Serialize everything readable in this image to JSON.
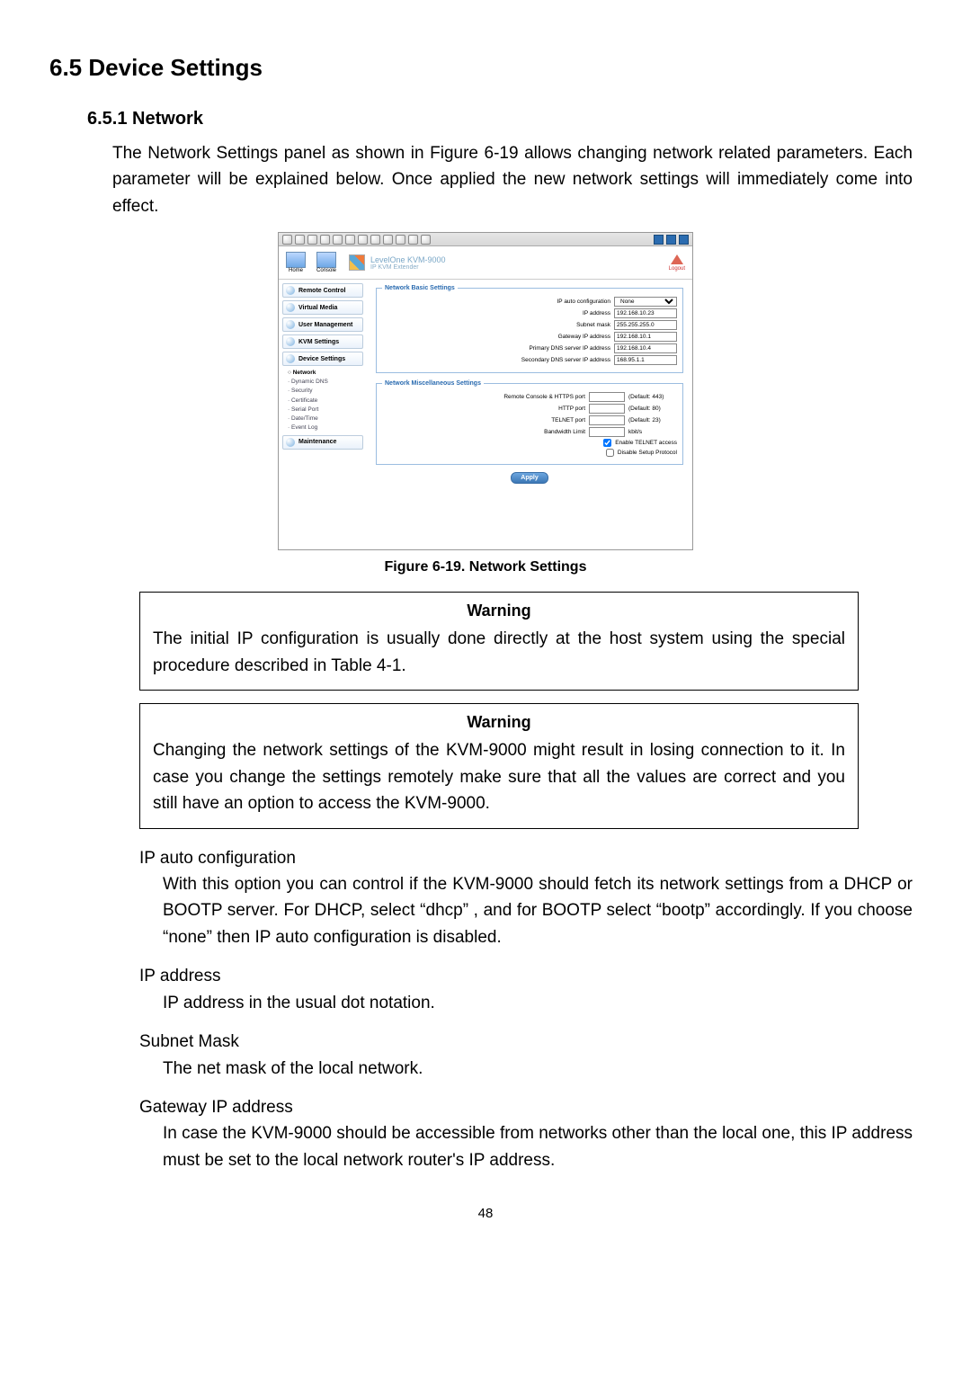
{
  "page": {
    "h1": "6.5 Device Settings",
    "h2": "6.5.1    Network",
    "intro": "The Network Settings panel as shown in Figure 6-19 allows changing network related parameters. Each parameter will be explained below. Once applied the new network settings will immediately come into effect.",
    "figure_caption": "Figure 6-19. Network Settings",
    "page_number": "48"
  },
  "shot": {
    "header": {
      "home_label": "Home",
      "console_label": "Console",
      "brand_top": "LevelOne KVM-9000",
      "brand_sub": "IP KVM Extender",
      "logout_label": "Logout"
    },
    "nav": {
      "items": [
        "Remote Control",
        "Virtual Media",
        "User Management",
        "KVM Settings",
        "Device Settings"
      ],
      "sub": [
        "Network",
        "Dynamic DNS",
        "Security",
        "Certificate",
        "Serial Port",
        "Date/Time",
        "Event Log"
      ],
      "maintenance": "Maintenance"
    },
    "basic": {
      "legend": "Network Basic Settings",
      "ip_auto_label": "IP auto configuration",
      "ip_auto_value": "None",
      "ip_label": "IP address",
      "ip_value": "192.168.10.23",
      "subnet_label": "Subnet mask",
      "subnet_value": "255.255.255.0",
      "gw_label": "Gateway IP address",
      "gw_value": "192.168.10.1",
      "pdns_label": "Primary DNS server IP address",
      "pdns_value": "192.168.10.4",
      "sdns_label": "Secondary DNS server IP address",
      "sdns_value": "168.95.1.1"
    },
    "misc": {
      "legend": "Network Miscellaneous Settings",
      "https_label": "Remote Console & HTTPS port",
      "https_hint": "(Default: 443)",
      "http_label": "HTTP port",
      "http_hint": "(Default: 80)",
      "telnet_label": "TELNET port",
      "telnet_hint": "(Default: 23)",
      "bw_label": "Bandwidth Limit",
      "bw_unit": "kbit/s",
      "telnet_enable": "Enable TELNET access",
      "setup_disable": "Disable Setup Protocol",
      "apply": "Apply"
    }
  },
  "warnings": {
    "title": "Warning",
    "w1": "The initial IP configuration is usually done directly at the host system using the special procedure described in Table 4-1.",
    "w2": "Changing the network settings of the KVM-9000 might result in losing connection to it. In case you change the settings remotely make sure that all the values are correct and you still have an option to access the KVM-9000."
  },
  "defs": {
    "t1": "IP auto configuration",
    "d1": "With this option you can control if the KVM-9000 should fetch its network settings from a DHCP or BOOTP server. For DHCP, select “dhcp” , and for BOOTP select “bootp” accordingly. If you choose “none” then IP auto configuration is disabled.",
    "t2": "IP address",
    "d2": "IP address in the usual dot notation.",
    "t3": "Subnet Mask",
    "d3": "The net mask of the local network.",
    "t4": "Gateway IP address",
    "d4": "In case the KVM-9000 should be accessible from networks other than the local one, this IP address must be set to the local network router's IP address."
  }
}
